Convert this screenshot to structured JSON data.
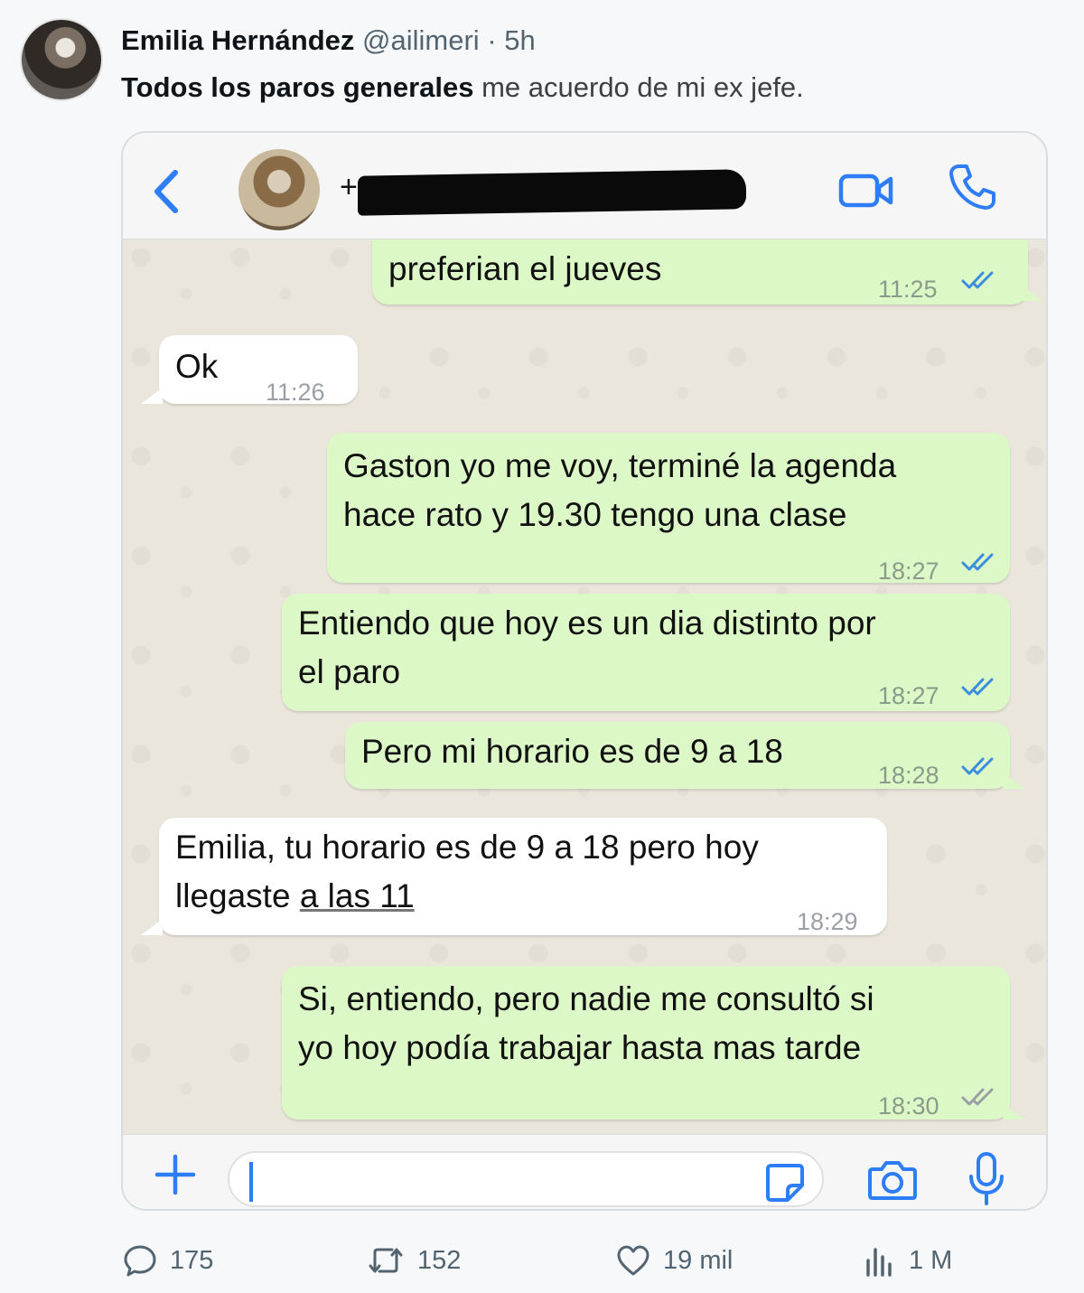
{
  "tweet": {
    "author_name": "Emilia Hernández",
    "handle": "@ailimeri",
    "separator": "·",
    "time": "5h",
    "text_bold": "Todos los paros generales",
    "text_rest": " me acuerdo de mi ex jefe."
  },
  "chat": {
    "contact_prefix": "+",
    "messages": [
      {
        "direction": "out",
        "lines": [
          "preferian el jueves"
        ],
        "time": "11:25",
        "ticks": "read"
      },
      {
        "direction": "in",
        "lines": [
          "Ok"
        ],
        "time": "11:26"
      },
      {
        "direction": "out",
        "lines": [
          "Gaston yo me voy, terminé la agenda",
          "hace rato y 19.30 tengo una clase"
        ],
        "time": "18:27",
        "ticks": "read"
      },
      {
        "direction": "out",
        "lines": [
          "Entiendo que hoy es un dia distinto por",
          "el paro"
        ],
        "time": "18:27",
        "ticks": "read"
      },
      {
        "direction": "out",
        "lines": [
          "Pero mi horario es de 9 a 18"
        ],
        "time": "18:28",
        "ticks": "read"
      },
      {
        "direction": "in",
        "lines": [
          "Emilia, tu horario es de 9 a 18 pero hoy",
          "llegaste ",
          "a las 11"
        ],
        "time": "18:29"
      },
      {
        "direction": "out",
        "lines": [
          "Si, entiendo, pero nadie me consultó si",
          "yo hoy podía trabajar hasta mas tarde"
        ],
        "time": "18:30",
        "ticks": "delivered"
      }
    ],
    "tick_colors": {
      "read": "#3b8ede",
      "delivered": "#9aa0a6"
    },
    "accent": "#2d7df6"
  },
  "actions": {
    "replies": "175",
    "retweets": "152",
    "likes": "19 mil",
    "views": "1 M"
  }
}
